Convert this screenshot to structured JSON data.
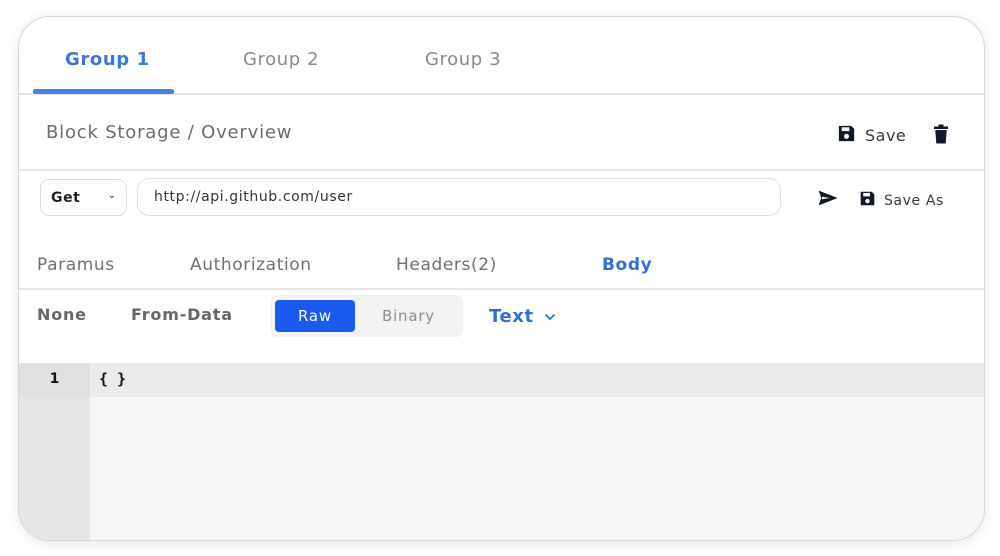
{
  "group_tabs": [
    {
      "label": "Group 1",
      "active": true
    },
    {
      "label": "Group 2",
      "active": false
    },
    {
      "label": "Group 3",
      "active": false
    }
  ],
  "breadcrumb": "Block Storage / Overview",
  "actions": {
    "save_label": "Save",
    "save_icon": "floppy-disk-icon",
    "delete_icon": "trash-icon"
  },
  "request": {
    "method": "Get",
    "url": "http://api.github.com/user",
    "send_icon": "send-icon",
    "save_as_label": "Save As"
  },
  "request_tabs": [
    {
      "label": "Paramus",
      "active": false
    },
    {
      "label": "Authorization",
      "active": false
    },
    {
      "label": "Headers(2)",
      "active": false
    },
    {
      "label": "Body",
      "active": true
    }
  ],
  "body_types": {
    "none": "None",
    "form_data": "From-Data",
    "raw": "Raw",
    "binary": "Binary",
    "selected": "Raw",
    "format": "Text"
  },
  "editor": {
    "lines": [
      {
        "number": "1",
        "content": "{ }"
      }
    ]
  },
  "colors": {
    "accent": "#3b78d8",
    "primary_button": "#1a5af0"
  }
}
